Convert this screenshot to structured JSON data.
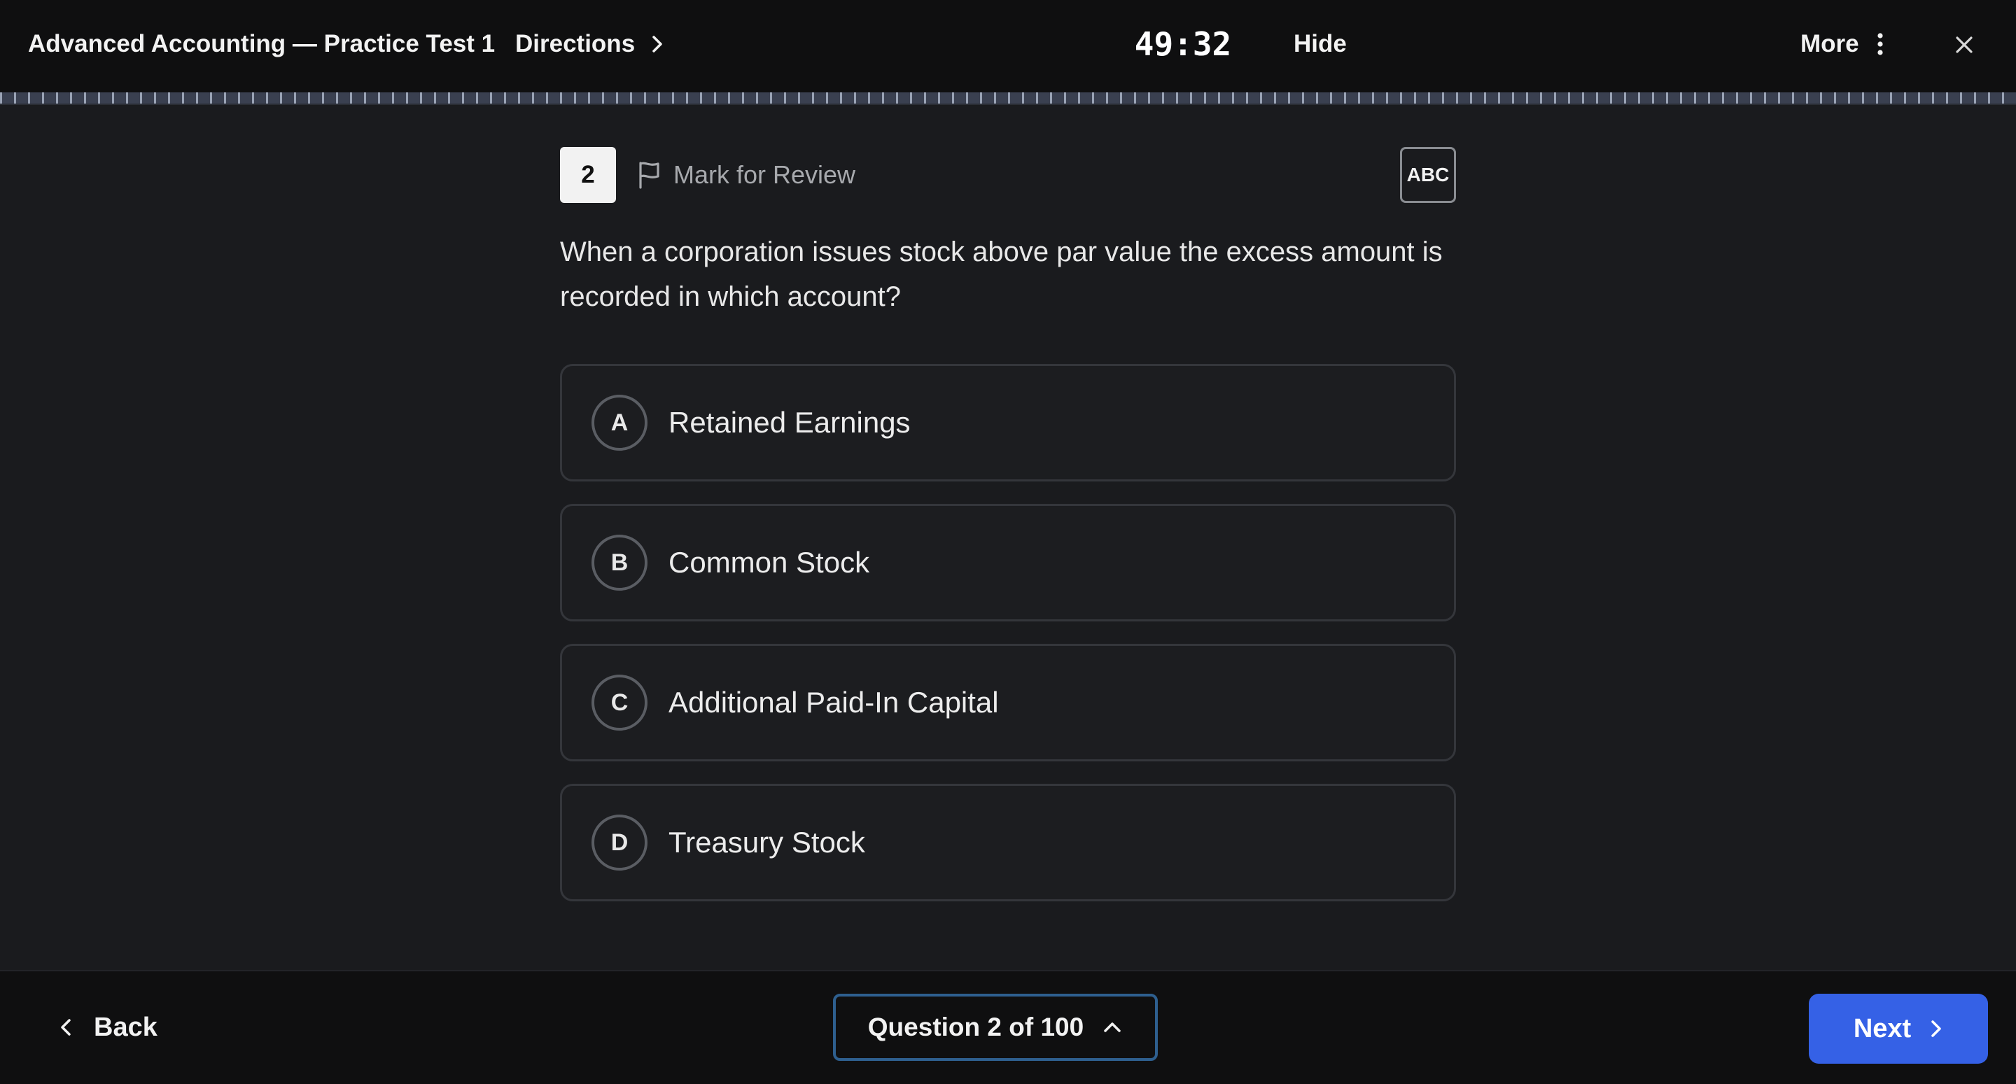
{
  "header": {
    "title": "Advanced Accounting — Practice Test 1",
    "directions_label": "Directions",
    "timer": "49:32",
    "hide_label": "Hide",
    "more_label": "More"
  },
  "question": {
    "number": "2",
    "mark_for_review_label": "Mark for Review",
    "abc_label": "ABC",
    "text": "When a corporation issues stock above par value the excess amount is recorded in which account?",
    "choices": [
      {
        "letter": "A",
        "text": "Retained Earnings"
      },
      {
        "letter": "B",
        "text": "Common Stock"
      },
      {
        "letter": "C",
        "text": "Additional Paid-In Capital"
      },
      {
        "letter": "D",
        "text": "Treasury Stock"
      }
    ]
  },
  "footer": {
    "back_label": "Back",
    "question_nav_label": "Question 2 of 100",
    "next_label": "Next"
  },
  "colors": {
    "background": "#1a1b1e",
    "bar": "#0f0f10",
    "accent": "#3561e6",
    "nav_border": "#2e5f8f"
  }
}
